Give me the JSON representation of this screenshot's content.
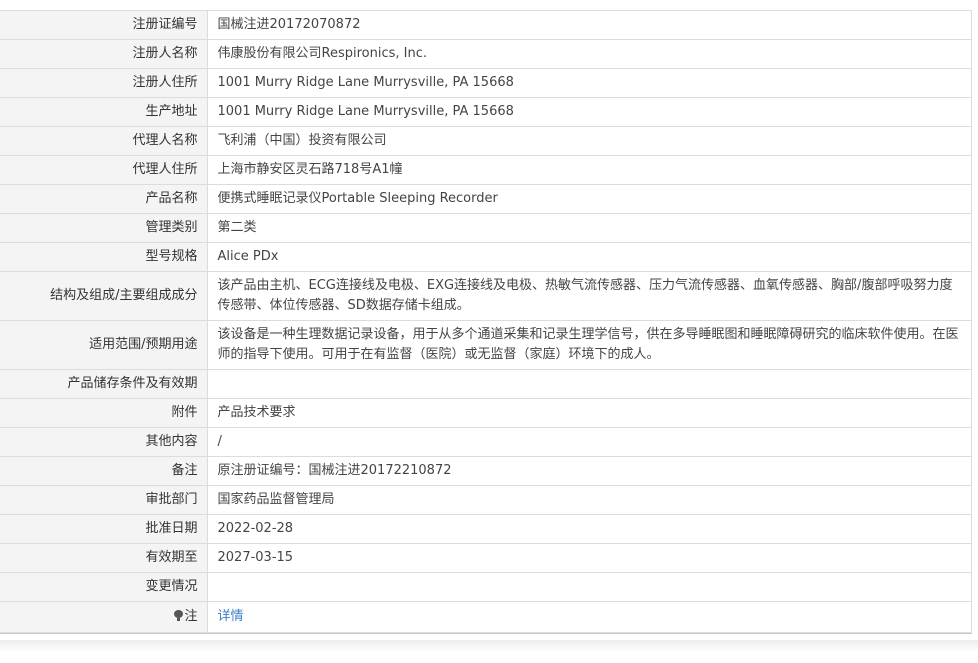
{
  "rows": [
    {
      "label": "注册证编号",
      "value": "国械注进20172070872"
    },
    {
      "label": "注册人名称",
      "value": "伟康股份有限公司Respironics, Inc."
    },
    {
      "label": "注册人住所",
      "value": "1001 Murry Ridge Lane Murrysville, PA 15668"
    },
    {
      "label": "生产地址",
      "value": "1001 Murry Ridge Lane Murrysville, PA 15668"
    },
    {
      "label": "代理人名称",
      "value": "飞利浦（中国）投资有限公司"
    },
    {
      "label": "代理人住所",
      "value": "上海市静安区灵石路718号A1幢"
    },
    {
      "label": "产品名称",
      "value": "便携式睡眠记录仪Portable Sleeping Recorder"
    },
    {
      "label": "管理类别",
      "value": "第二类"
    },
    {
      "label": "型号规格",
      "value": "Alice PDx"
    },
    {
      "label": "结构及组成/主要组成成分",
      "value": "该产品由主机、ECG连接线及电极、EXG连接线及电极、热敏气流传感器、压力气流传感器、血氧传感器、胸部/腹部呼吸努力度传感带、体位传感器、SD数据存储卡组成。"
    },
    {
      "label": "适用范围/预期用途",
      "value": "该设备是一种生理数据记录设备，用于从多个通道采集和记录生理学信号，供在多导睡眠图和睡眠障碍研究的临床软件使用。在医师的指导下使用。可用于在有监督（医院）或无监督（家庭）环境下的成人。"
    },
    {
      "label": "产品储存条件及有效期",
      "value": ""
    },
    {
      "label": "附件",
      "value": "产品技术要求"
    },
    {
      "label": "其他内容",
      "value": "/"
    },
    {
      "label": "备注",
      "value": "原注册证编号：国械注进20172210872"
    },
    {
      "label": "审批部门",
      "value": "国家药品监督管理局"
    },
    {
      "label": "批准日期",
      "value": "2022-02-28"
    },
    {
      "label": "有效期至",
      "value": "2027-03-15"
    },
    {
      "label": "变更情况",
      "value": ""
    }
  ],
  "note": {
    "label": "注",
    "link_text": "详情"
  },
  "icons": {
    "note_icon": "lightbulb-icon"
  },
  "colors": {
    "link": "#3a7fc8",
    "label_bg": "#f4f4f4",
    "border": "#dcdcdc"
  }
}
